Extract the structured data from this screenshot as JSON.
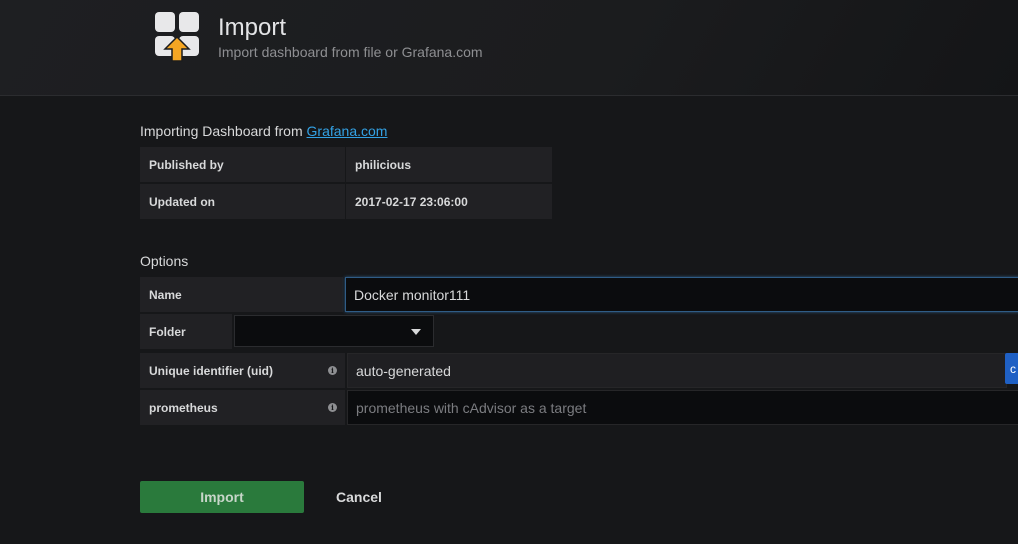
{
  "header": {
    "title": "Import",
    "subtitle": "Import dashboard from file or Grafana.com"
  },
  "source": {
    "prefix": "Importing Dashboard from ",
    "link": "Grafana.com"
  },
  "info": [
    {
      "label": "Published by",
      "value": "philicious"
    },
    {
      "label": "Updated on",
      "value": "2017-02-17 23:06:00"
    }
  ],
  "options": {
    "title": "Options",
    "name_label": "Name",
    "name_value": "Docker monitor111",
    "folder_label": "Folder",
    "folder_value": "",
    "uid_label": "Unique identifier (uid)",
    "uid_value": "auto-generated",
    "uid_button": "c",
    "prometheus_label": "prometheus",
    "prometheus_placeholder": "prometheus with cAdvisor as a target"
  },
  "actions": {
    "import_label": "Import",
    "cancel_label": "Cancel"
  },
  "colors": {
    "accent_blue": "#1f60c4",
    "import_green": "#2a7a3c",
    "icon_orange": "#f5a623",
    "link": "#33a2e5"
  },
  "icons": [
    "import-dashboard-icon",
    "info-icon",
    "chevron-down-icon"
  ]
}
